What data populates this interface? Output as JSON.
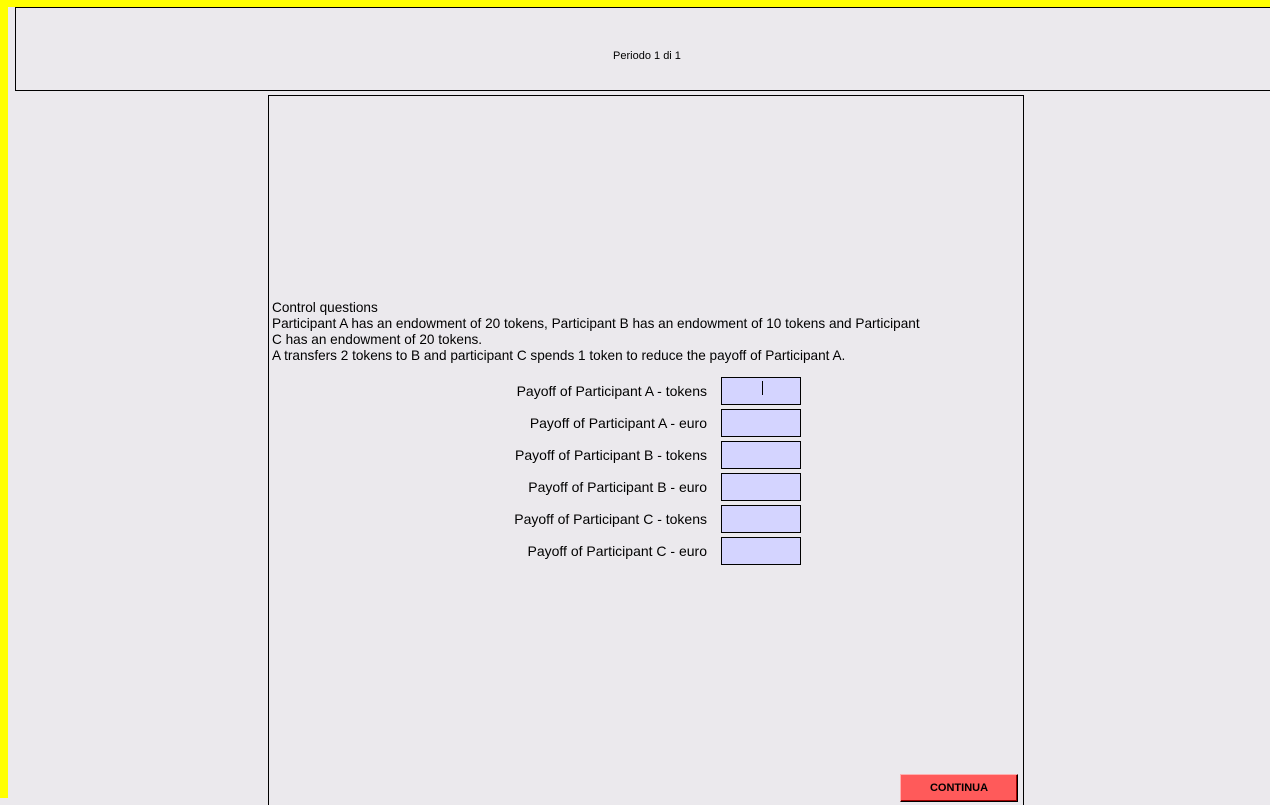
{
  "header": {
    "period_label": "Periodo 1 di 1"
  },
  "question": {
    "title": "Control questions",
    "lines": [
      "Participant A has an endowment of 20 tokens, Participant B has an endowment of  10 tokens and Participant",
      "C has an endowment of 20 tokens.",
      "A transfers 2 tokens to B and participant C spends 1 token to reduce the payoff of Participant A."
    ]
  },
  "fields": [
    {
      "label": "Payoff of Participant A - tokens",
      "value": ""
    },
    {
      "label": "Payoff of Participant A - euro",
      "value": ""
    },
    {
      "label": "Payoff of Participant B - tokens",
      "value": ""
    },
    {
      "label": "Payoff of Participant B - euro",
      "value": ""
    },
    {
      "label": "Payoff of Participant C - tokens",
      "value": ""
    },
    {
      "label": "Payoff of Participant C - euro",
      "value": ""
    }
  ],
  "buttons": {
    "continue_label": "CONTINUA"
  },
  "colors": {
    "frame_accent": "#ffff00",
    "background": "#ebe9ed",
    "input_fill": "#d4d4ff",
    "button_fill": "#ff5a5a"
  }
}
